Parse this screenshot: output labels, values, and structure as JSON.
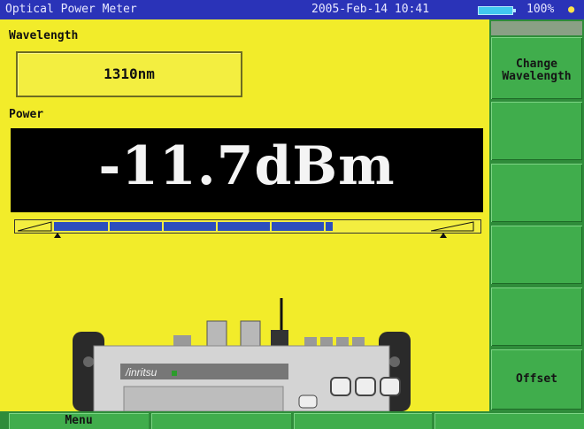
{
  "titlebar": {
    "app_title": "Optical Power Meter",
    "datetime": "2005-Feb-14 10:41",
    "battery_percent": "100%",
    "battery_level": 1.0
  },
  "wavelength": {
    "label": "Wavelength",
    "value": "1310nm"
  },
  "power": {
    "label": "Power",
    "value": "-11.7dBm",
    "bar_level": 0.73
  },
  "softkeys": [
    {
      "line1": "Change",
      "line2": "Wavelength"
    },
    {
      "line1": "",
      "line2": ""
    },
    {
      "line1": "",
      "line2": ""
    },
    {
      "line1": "",
      "line2": ""
    },
    {
      "line1": "",
      "line2": ""
    },
    {
      "line1": "Offset",
      "line2": ""
    }
  ],
  "bottom_keys": [
    "Menu",
    "",
    "",
    ""
  ],
  "device": {
    "brand": "/inritsu"
  },
  "colors": {
    "background": "#f2ec2a",
    "titlebar": "#2a33b8",
    "softkey": "#40ad4c",
    "power_display": "#000000",
    "bar_fill": "#2c4ebd"
  }
}
